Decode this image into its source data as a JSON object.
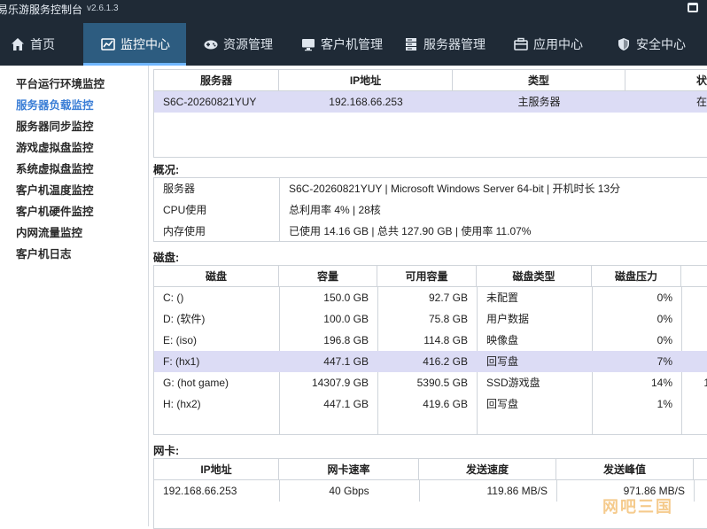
{
  "window": {
    "title": "易乐游服务控制台",
    "version": "v2.6.1.3"
  },
  "nav": [
    {
      "label": "首页",
      "icon": "home-icon"
    },
    {
      "label": "监控中心",
      "icon": "chart-icon"
    },
    {
      "label": "资源管理",
      "icon": "gamepad-icon"
    },
    {
      "label": "客户机管理",
      "icon": "monitor-icon"
    },
    {
      "label": "服务器管理",
      "icon": "server-icon"
    },
    {
      "label": "应用中心",
      "icon": "app-icon"
    },
    {
      "label": "安全中心",
      "icon": "shield-icon"
    }
  ],
  "sidebar": [
    "平台运行环境监控",
    "服务器负载监控",
    "服务器同步监控",
    "游戏虚拟盘监控",
    "系统虚拟盘监控",
    "客户机温度监控",
    "客户机硬件监控",
    "内网流量监控",
    "客户机日志"
  ],
  "servers": {
    "headers": [
      "服务器",
      "IP地址",
      "类型",
      "状"
    ],
    "rows": [
      [
        "S6C-20260821YUY",
        "192.168.66.253",
        "主服务器",
        "在"
      ]
    ]
  },
  "overview": {
    "label": "概况:",
    "rows": [
      [
        "服务器",
        "S6C-20260821YUY | Microsoft Windows Server 64-bit | 开机时长 13分"
      ],
      [
        "CPU使用",
        "总利用率 4% | 28核"
      ],
      [
        "内存使用",
        "已使用 14.16  GB | 总共 127.90  GB | 使用率 11.07%"
      ]
    ]
  },
  "disks": {
    "label": "磁盘:",
    "headers": [
      "磁盘",
      "容量",
      "可用容量",
      "磁盘类型",
      "磁盘压力"
    ],
    "rows": [
      [
        "C: ()",
        "150.0  GB",
        "92.7  GB",
        "未配置",
        "0%",
        ""
      ],
      [
        "D: (软件)",
        "100.0  GB",
        "75.8  GB",
        "用户数据",
        "0%",
        ""
      ],
      [
        "E: (iso)",
        "196.8  GB",
        "114.8  GB",
        "映像盘",
        "0%",
        ""
      ],
      [
        "F: (hx1)",
        "447.1  GB",
        "416.2  GB",
        "回写盘",
        "7%",
        ""
      ],
      [
        "G: (hot game)",
        "14307.9  GB",
        "5390.5  GB",
        "SSD游戏盘",
        "14%",
        "1"
      ],
      [
        "H: (hx2)",
        "447.1  GB",
        "419.6  GB",
        "回写盘",
        "1%",
        ""
      ]
    ]
  },
  "nics": {
    "label": "网卡:",
    "headers": [
      "IP地址",
      "网卡速率",
      "发送速度",
      "发送峰值"
    ],
    "rows": [
      [
        "192.168.66.253",
        "40 Gbps",
        "119.86  MB/S",
        "971.86  MB/S"
      ]
    ]
  },
  "watermark": "网吧三国"
}
